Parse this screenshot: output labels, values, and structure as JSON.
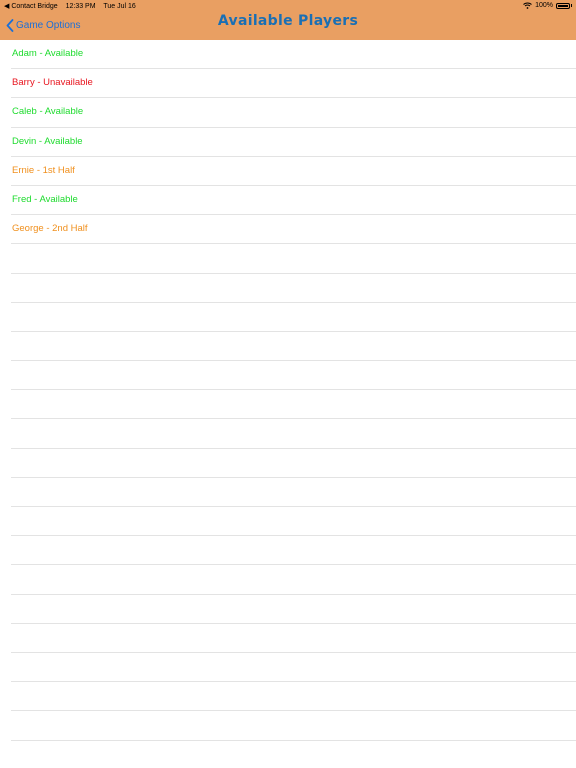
{
  "status_bar": {
    "back_app": "◀ Contact Bridge",
    "time": "12:33 PM",
    "date": "Tue Jul 16",
    "battery": "100%"
  },
  "nav": {
    "back_label": "Game Options",
    "title": "Available Players"
  },
  "players": [
    {
      "label": "Adam - Available",
      "status": "available"
    },
    {
      "label": "Barry - Unavailable",
      "status": "unavailable"
    },
    {
      "label": "Caleb - Available",
      "status": "available"
    },
    {
      "label": "Devin - Available",
      "status": "available"
    },
    {
      "label": "Ernie - 1st Half",
      "status": "partial"
    },
    {
      "label": "Fred - Available",
      "status": "available"
    },
    {
      "label": "George - 2nd Half",
      "status": "partial"
    }
  ],
  "empty_rows": 17,
  "colors": {
    "header_bg": "#e99f62",
    "title": "#1a6fb4",
    "back_link": "#1a6fd8",
    "available": "#1ddb2d",
    "unavailable": "#e8151f",
    "partial": "#f0901e"
  }
}
